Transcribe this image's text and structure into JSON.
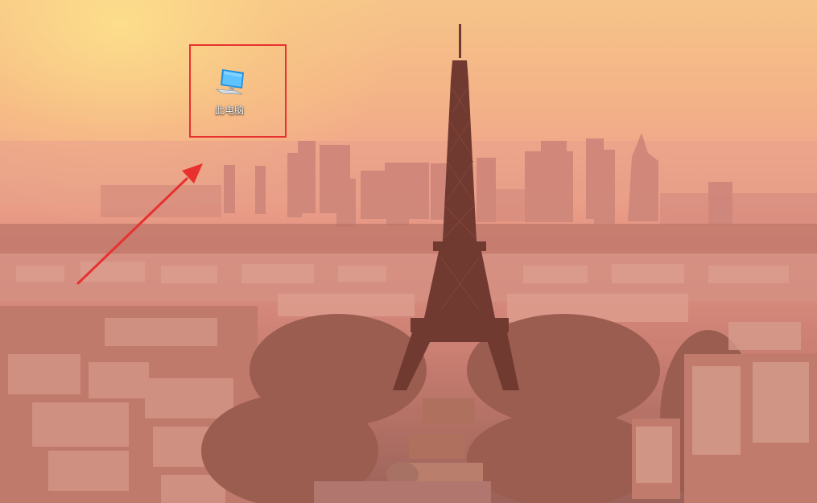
{
  "desktop": {
    "icons": [
      {
        "label": "此电脑",
        "icon": "monitor-icon"
      }
    ]
  },
  "annotation": {
    "box_color": "#e8312f",
    "arrow_color": "#e8312f"
  }
}
